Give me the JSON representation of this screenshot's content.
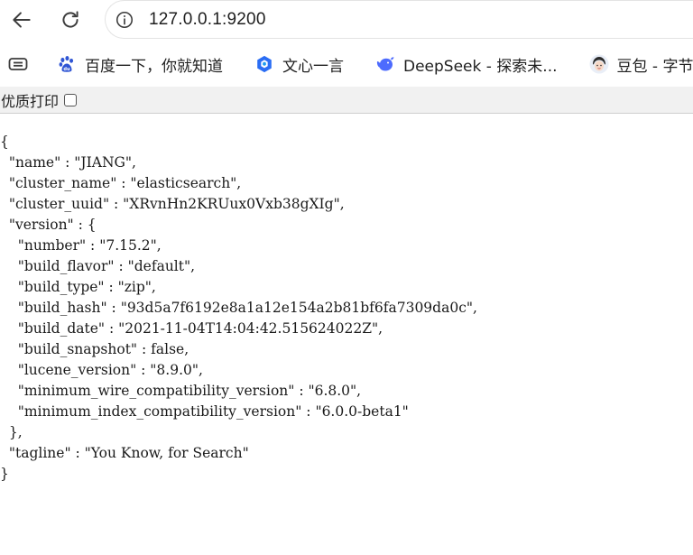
{
  "address_bar": {
    "url": "127.0.0.1:9200"
  },
  "bookmarks": [
    {
      "label": "百度一下，你就知道",
      "icon": "baidu-paw-icon"
    },
    {
      "label": "文心一言",
      "icon": "wenxin-cube-icon"
    },
    {
      "label": "DeepSeek - 探索未...",
      "icon": "deepseek-whale-icon"
    },
    {
      "label": "豆包 - 字节",
      "icon": "doubao-avatar-icon"
    }
  ],
  "pretty_print": {
    "label": "优质打印",
    "checked": false
  },
  "json_lines": [
    "{",
    "  \"name\" : \"JIANG\",",
    "  \"cluster_name\" : \"elasticsearch\",",
    "  \"cluster_uuid\" : \"XRvnHn2KRUux0Vxb38gXIg\",",
    "  \"version\" : {",
    "    \"number\" : \"7.15.2\",",
    "    \"build_flavor\" : \"default\",",
    "    \"build_type\" : \"zip\",",
    "    \"build_hash\" : \"93d5a7f6192e8a1a12e154a2b81bf6fa7309da0c\",",
    "    \"build_date\" : \"2021-11-04T14:04:42.515624022Z\",",
    "    \"build_snapshot\" : false,",
    "    \"lucene_version\" : \"8.9.0\",",
    "    \"minimum_wire_compatibility_version\" : \"6.8.0\",",
    "    \"minimum_index_compatibility_version\" : \"6.0.0-beta1\"",
    "  },",
    "  \"tagline\" : \"You Know, for Search\"",
    "}"
  ]
}
